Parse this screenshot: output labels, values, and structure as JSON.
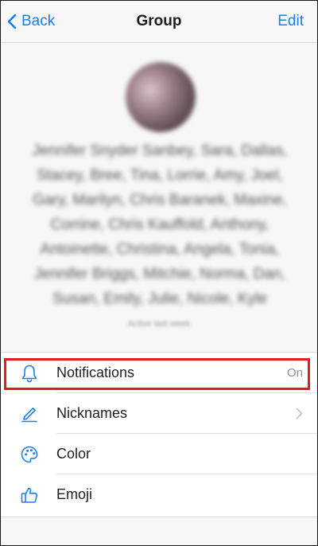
{
  "navbar": {
    "back_label": "Back",
    "title": "Group",
    "edit_label": "Edit"
  },
  "header": {
    "member_names": "Jennifer Snyder Sanbey, Sara, Dallas, Stacey, Bree, Tina, Lorrie, Amy, Joel, Gary, Marilyn, Chris Baranek, Maxine, Corrine, Chris Kauffold, Anthony, Antoinette, Christina, Angela, Tonia, Jennifer Briggs, Mitchie, Norma, Dan, Susan, Emily, Julie, Nicole, Kyle",
    "member_count": "Active last week"
  },
  "settings": {
    "rows": [
      {
        "label": "Notifications",
        "value": "On",
        "icon": "bell-icon"
      },
      {
        "label": "Nicknames",
        "icon": "pencil-icon"
      },
      {
        "label": "Color",
        "icon": "palette-icon"
      },
      {
        "label": "Emoji",
        "icon": "thumbs-up-icon"
      }
    ]
  },
  "colors": {
    "accent": "#1a7ef0",
    "highlight": "#e21b1b"
  }
}
